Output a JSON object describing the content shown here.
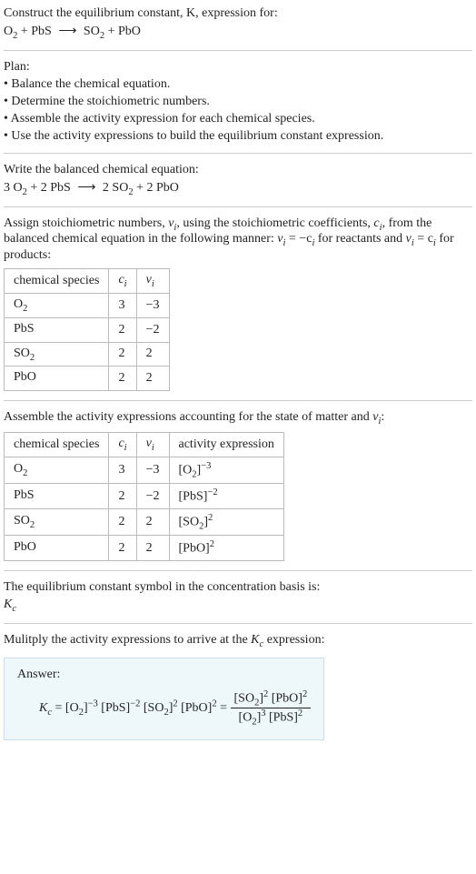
{
  "header": {
    "prompt": "Construct the equilibrium constant, K, expression for:",
    "equation_reactants_1": "O",
    "equation_reactants_1_sub": "2",
    "equation_plus_1": " + PbS",
    "equation_arrow": "⟶",
    "equation_products_1": "SO",
    "equation_products_1_sub": "2",
    "equation_plus_2": " + PbO"
  },
  "plan": {
    "title": "Plan:",
    "step1": "• Balance the chemical equation.",
    "step2": "• Determine the stoichiometric numbers.",
    "step3": "• Assemble the activity expression for each chemical species.",
    "step4": "• Use the activity expressions to build the equilibrium constant expression."
  },
  "balanced": {
    "title": "Write the balanced chemical equation:",
    "coef1": "3 O",
    "sub1": "2",
    "plus1": " + 2 PbS",
    "arrow": "⟶",
    "coef2": "2 SO",
    "sub2": "2",
    "plus2": " + 2 PbO"
  },
  "assign": {
    "text_a": "Assign stoichiometric numbers, ",
    "nu_i": "ν",
    "nu_i_sub": "i",
    "text_b": ", using the stoichiometric coefficients, ",
    "c_i": "c",
    "c_i_sub": "i",
    "text_c": ", from the balanced chemical equation in the following manner: ",
    "nu_eq": "ν",
    "eq1_sub": "i",
    "eq1_eq": " = −c",
    "eq1_sub2": "i",
    "text_d": " for reactants and ",
    "eq2_nu": "ν",
    "eq2_sub": "i",
    "eq2_eq": " = c",
    "eq2_sub2": "i",
    "text_e": " for products:"
  },
  "table1": {
    "h1": "chemical species",
    "h2": "c",
    "h2_sub": "i",
    "h3": "ν",
    "h3_sub": "i",
    "rows": [
      {
        "sp_a": "O",
        "sp_sub": "2",
        "c": "3",
        "nu": "−3"
      },
      {
        "sp_a": "PbS",
        "sp_sub": "",
        "c": "2",
        "nu": "−2"
      },
      {
        "sp_a": "SO",
        "sp_sub": "2",
        "c": "2",
        "nu": "2"
      },
      {
        "sp_a": "PbO",
        "sp_sub": "",
        "c": "2",
        "nu": "2"
      }
    ]
  },
  "assemble": {
    "text_a": "Assemble the activity expressions accounting for the state of matter and ",
    "nu": "ν",
    "nu_sub": "i",
    "text_b": ":"
  },
  "table2": {
    "h1": "chemical species",
    "h2": "c",
    "h2_sub": "i",
    "h3": "ν",
    "h3_sub": "i",
    "h4": "activity expression",
    "rows": [
      {
        "sp_a": "O",
        "sp_sub": "2",
        "c": "3",
        "nu": "−3",
        "ae_a": "[O",
        "ae_sub": "2",
        "ae_b": "]",
        "ae_sup": "−3"
      },
      {
        "sp_a": "PbS",
        "sp_sub": "",
        "c": "2",
        "nu": "−2",
        "ae_a": "[PbS]",
        "ae_sub": "",
        "ae_b": "",
        "ae_sup": "−2"
      },
      {
        "sp_a": "SO",
        "sp_sub": "2",
        "c": "2",
        "nu": "2",
        "ae_a": "[SO",
        "ae_sub": "2",
        "ae_b": "]",
        "ae_sup": "2"
      },
      {
        "sp_a": "PbO",
        "sp_sub": "",
        "c": "2",
        "nu": "2",
        "ae_a": "[PbO]",
        "ae_sub": "",
        "ae_b": "",
        "ae_sup": "2"
      }
    ]
  },
  "symbol": {
    "text": "The equilibrium constant symbol in the concentration basis is:",
    "K": "K",
    "K_sub": "c"
  },
  "multiply": {
    "text_a": "Mulitply the activity expressions to arrive at the ",
    "K": "K",
    "K_sub": "c",
    "text_b": " expression:"
  },
  "answer": {
    "label": "Answer:",
    "lhs_K": "K",
    "lhs_K_sub": "c",
    "eq": " = ",
    "t1_a": "[O",
    "t1_sub": "2",
    "t1_b": "]",
    "t1_sup": "−3",
    "t2_a": " [PbS]",
    "t2_sup": "−2",
    "t3_a": " [SO",
    "t3_sub": "2",
    "t3_b": "]",
    "t3_sup": "2",
    "t4_a": " [PbO]",
    "t4_sup": "2",
    "eq2": " = ",
    "num_a": "[SO",
    "num_sub": "2",
    "num_b": "]",
    "num_sup": "2",
    "num2_a": " [PbO]",
    "num2_sup": "2",
    "den_a": "[O",
    "den_sub": "2",
    "den_b": "]",
    "den_sup": "3",
    "den2_a": " [PbS]",
    "den2_sup": "2"
  },
  "chart_data": {
    "type": "table",
    "tables": [
      {
        "title": "Stoichiometric numbers",
        "columns": [
          "chemical species",
          "c_i",
          "ν_i"
        ],
        "rows": [
          [
            "O2",
            3,
            -3
          ],
          [
            "PbS",
            2,
            -2
          ],
          [
            "SO2",
            2,
            2
          ],
          [
            "PbO",
            2,
            2
          ]
        ]
      },
      {
        "title": "Activity expressions",
        "columns": [
          "chemical species",
          "c_i",
          "ν_i",
          "activity expression"
        ],
        "rows": [
          [
            "O2",
            3,
            -3,
            "[O2]^-3"
          ],
          [
            "PbS",
            2,
            -2,
            "[PbS]^-2"
          ],
          [
            "SO2",
            2,
            2,
            "[SO2]^2"
          ],
          [
            "PbO",
            2,
            2,
            "[PbO]^2"
          ]
        ]
      }
    ]
  }
}
